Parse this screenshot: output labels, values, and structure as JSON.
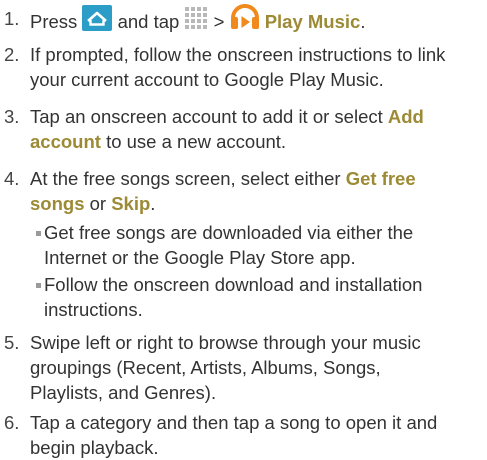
{
  "steps": [
    {
      "number": "1.",
      "parts": {
        "press": "Press",
        "and_tap": "and tap",
        "gt": ">",
        "app_name": "Play Music",
        "period": "."
      }
    },
    {
      "number": "2.",
      "lines": [
        "If prompted, follow the onscreen instructions to link",
        "your current account to Google Play Music."
      ]
    },
    {
      "number": "3.",
      "parts": {
        "pre": "Tap an onscreen account to add it or select",
        "add_1": "Add",
        "add_2": "account",
        "post": "to use a new account."
      }
    },
    {
      "number": "4.",
      "parts": {
        "pre": "At the free songs screen, select either",
        "get_1": "Get free",
        "get_2": "songs",
        "or": "or",
        "skip": "Skip",
        "period": "."
      },
      "bullets": [
        {
          "lines": [
            "Get free songs are downloaded via either the",
            "Internet or the Google Play Store app."
          ]
        },
        {
          "lines": [
            "Follow the onscreen download and installation",
            "instructions."
          ]
        }
      ]
    },
    {
      "number": "5.",
      "lines": [
        "Swipe left or right to browse through your music",
        "groupings (Recent, Artists, Albums, Songs,",
        "Playlists, and Genres)."
      ]
    },
    {
      "number": "6.",
      "lines": [
        "Tap a category and then tap a song to open it and",
        "begin playback."
      ]
    }
  ],
  "icons": {
    "home": "home-icon",
    "apps": "apps-grid-icon",
    "play_music": "play-music-icon"
  },
  "colors": {
    "text": "#333333",
    "highlight": "#9c8a35",
    "home_icon_bg": "#2b9dc7",
    "apps_icon": "#b8b8b8",
    "play_music_orange": "#f08a1c"
  }
}
